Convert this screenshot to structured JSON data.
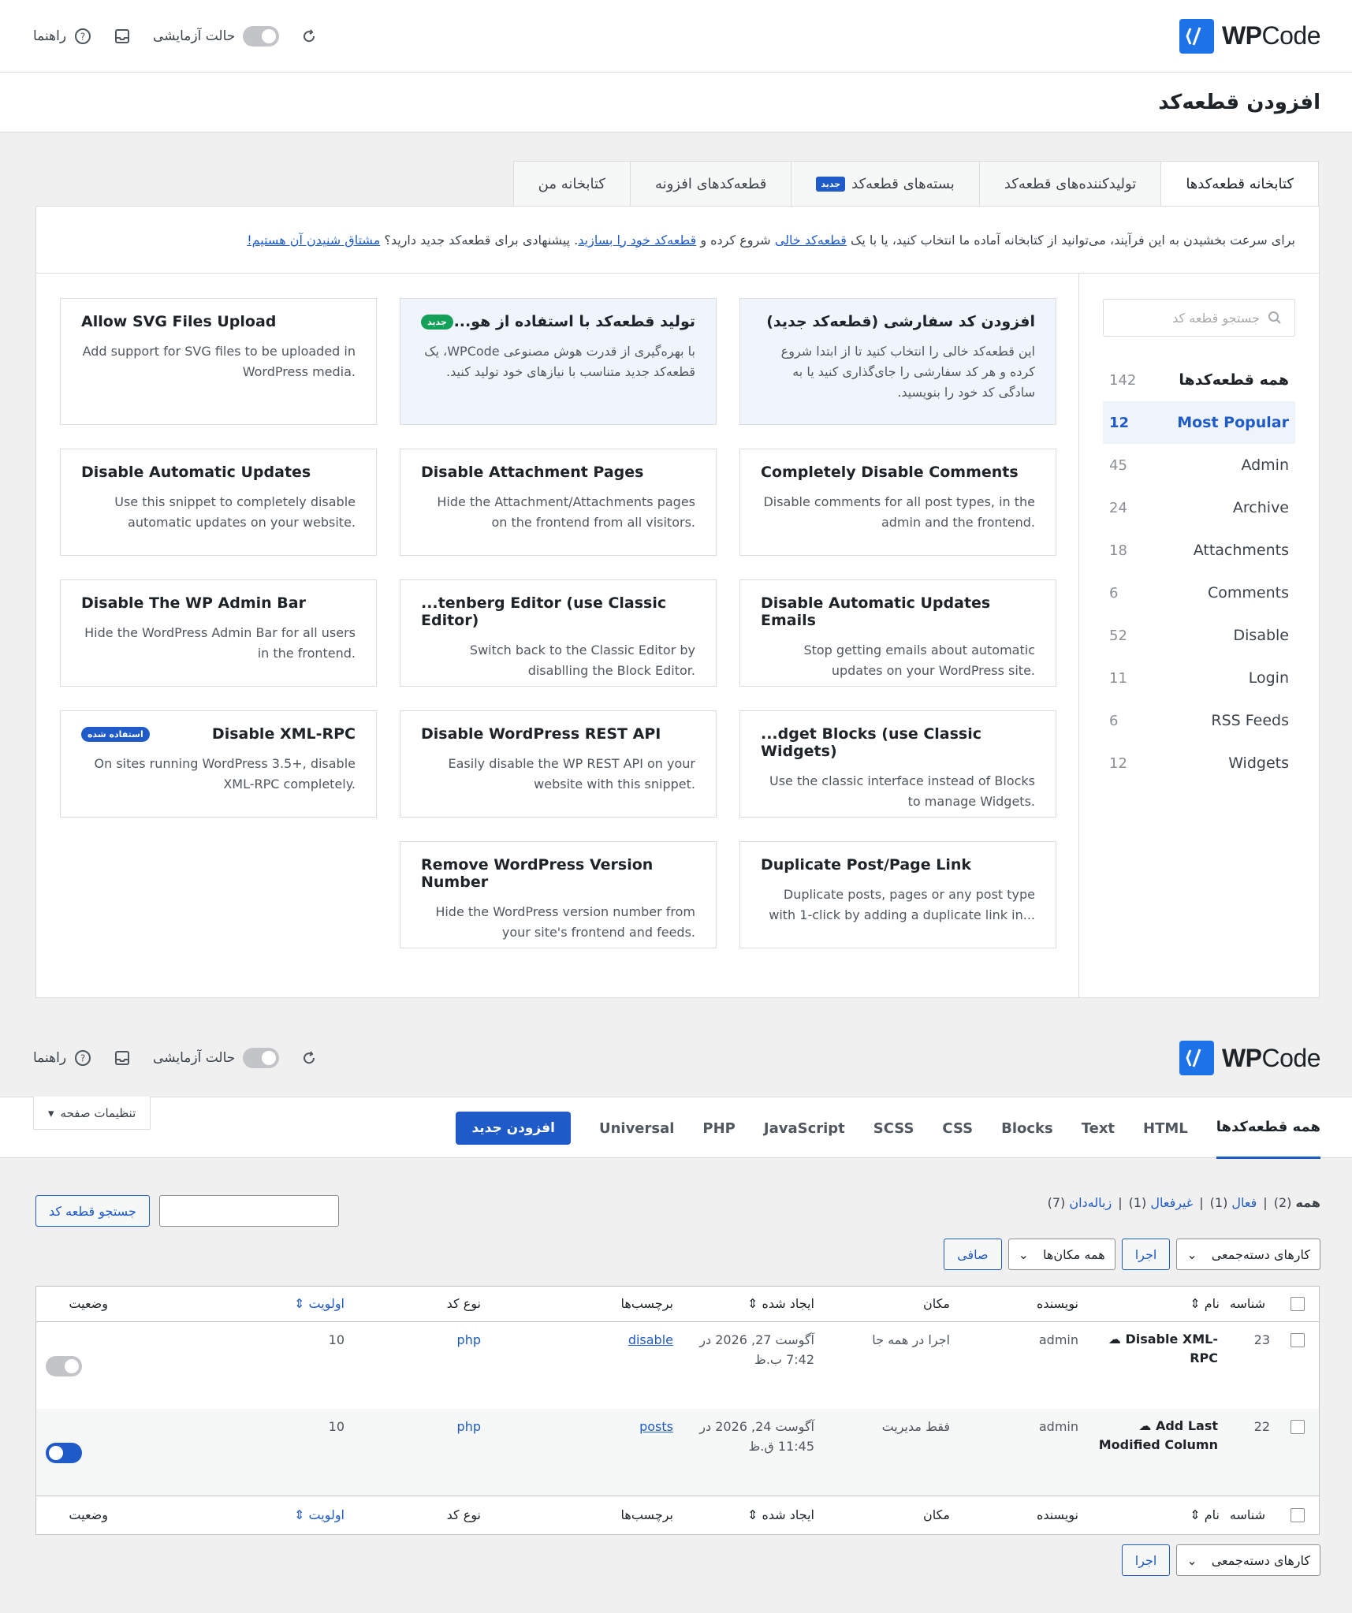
{
  "brand": {
    "name_bold": "WP",
    "name_rest": "Code"
  },
  "header_tools": {
    "help": "راهنما",
    "test_mode": "حالت آزمایشی"
  },
  "page_title": "افزودن قطعه‌کد",
  "library_tabs": [
    {
      "label": "کتابخانه قطعه‌کدها",
      "active": true
    },
    {
      "label": "تولیدکننده‌های قطعه‌کد"
    },
    {
      "label": "بسته‌های قطعه‌کد",
      "badge": "جدید"
    },
    {
      "label": "قطعه‌کدهای افزونه"
    },
    {
      "label": "کتابخانه من"
    }
  ],
  "intro": {
    "part1": "برای سرعت بخشیدن به این فرآیند، می‌توانید از کتابخانه آماده ما انتخاب کنید، یا با یک ",
    "link1": "قطعه‌کد خالی",
    "part2": " شروع کرده و ",
    "link2": "قطعه‌کد خود را بسازید",
    "part3": ". پیشنهادی برای قطعه‌کد جدید دارید؟ ",
    "link3": "مشتاق شنیدن آن هستیم!"
  },
  "search": {
    "placeholder": "جستجو قطعه کد"
  },
  "categories": [
    {
      "label": "همه قطعه‌کدها",
      "count": "142"
    },
    {
      "label": "Most Popular",
      "count": "12"
    },
    {
      "label": "Admin",
      "count": "45"
    },
    {
      "label": "Archive",
      "count": "24"
    },
    {
      "label": "Attachments",
      "count": "18"
    },
    {
      "label": "Comments",
      "count": "6"
    },
    {
      "label": "Disable",
      "count": "52"
    },
    {
      "label": "Login",
      "count": "11"
    },
    {
      "label": "RSS Feeds",
      "count": "6"
    },
    {
      "label": "Widgets",
      "count": "12"
    }
  ],
  "cards": [
    {
      "title": "افزودن کد سفارشی (قطعه‌کد جدید)",
      "desc": "این قطعه‌کد خالی را انتخاب کنید تا از ابتدا شروع کرده و هر کد سفارشی را جای‌گذاری کنید یا به سادگی کد خود را بنویسید."
    },
    {
      "title": "تولید قطعه‌کد با استفاده از هو...",
      "desc": "با بهره‌گیری از قدرت هوش مصنوعی WPCode، یک قطعه‌کد جدید متناسب با نیازهای خود تولید کنید.",
      "badge": "جدید"
    },
    {
      "title": "Allow SVG Files Upload",
      "desc": "Add support for SVG files to be uploaded in WordPress media."
    },
    {
      "title": "Completely Disable Comments",
      "desc": "Disable comments for all post types, in the admin and the frontend."
    },
    {
      "title": "Disable Attachment Pages",
      "desc": "Hide the Attachment/Attachments pages on the frontend from all visitors."
    },
    {
      "title": "Disable Automatic Updates",
      "desc": "Use this snippet to completely disable automatic updates on your website."
    },
    {
      "title": "Disable Automatic Updates Emails",
      "desc": "Stop getting emails about automatic updates on your WordPress site."
    },
    {
      "title": "...tenberg Editor (use Classic Editor)",
      "desc": "Switch back to the Classic Editor by disablling the Block Editor."
    },
    {
      "title": "Disable The WP Admin Bar",
      "desc": "Hide the WordPress Admin Bar for all users in the frontend."
    },
    {
      "title": "...dget Blocks (use Classic Widgets)",
      "desc": "Use the classic interface instead of Blocks to manage Widgets."
    },
    {
      "title": "Disable WordPress REST API",
      "desc": "Easily disable the WP REST API on your website with this snippet."
    },
    {
      "title": "Disable XML-RPC",
      "desc": "On sites running WordPress 3.5+, disable XML-RPC completely.",
      "badge": "استفاده شده"
    },
    {
      "title": "Duplicate Post/Page Link",
      "desc": "Duplicate posts, pages or any post type with 1-click by adding a duplicate link in..."
    },
    {
      "title": "Remove WordPress Version Number",
      "desc": "Hide the WordPress version number from your site's frontend and feeds."
    }
  ],
  "snippet_tabs": [
    "همه قطعه‌کدها",
    "HTML",
    "Text",
    "Blocks",
    "CSS",
    "SCSS",
    "JavaScript",
    "PHP",
    "Universal"
  ],
  "add_new": "افزودن جدید",
  "screen_options": "تنظیمات صفحه",
  "filters": {
    "all": "همه",
    "all_count": "(2)",
    "active": "فعال",
    "active_count": "(1)",
    "inactive": "غیرفعال",
    "inactive_count": "(1)",
    "trash": "زباله‌دان",
    "trash_count": "(7)"
  },
  "search_snippets_btn": "جستجو قطعه کد",
  "bulk_actions": "کارهای دسته‌جمعی",
  "apply": "اجرا",
  "all_locations": "همه مکان‌ها",
  "filter_btn": "صافی",
  "columns": {
    "id": "شناسه",
    "name": "نام",
    "author": "نویسنده",
    "location": "مکان",
    "created": "ایجاد شده",
    "tags": "برچسب‌ها",
    "code_type": "نوع کد",
    "priority": "اولویت",
    "status": "وضعیت"
  },
  "rows": [
    {
      "id": "23",
      "name": "Disable XML-RPC",
      "author": "admin",
      "location": "اجرا در همه جا",
      "created": "آگوست 27, 2026 در 7:42 ب.ظ",
      "tag": "disable",
      "type": "php",
      "priority": "10",
      "active": false
    },
    {
      "id": "22",
      "name": "Add Last Modified Column",
      "author": "admin",
      "location": "فقط مدیریت",
      "created": "آگوست 24, 2026 در 11:45 ق.ظ",
      "tag": "posts",
      "type": "php",
      "priority": "10",
      "active": true
    }
  ],
  "colors": {
    "accent": "#1e5ac8",
    "logo": "#1e72e8",
    "new_badge": "#15a05a"
  }
}
